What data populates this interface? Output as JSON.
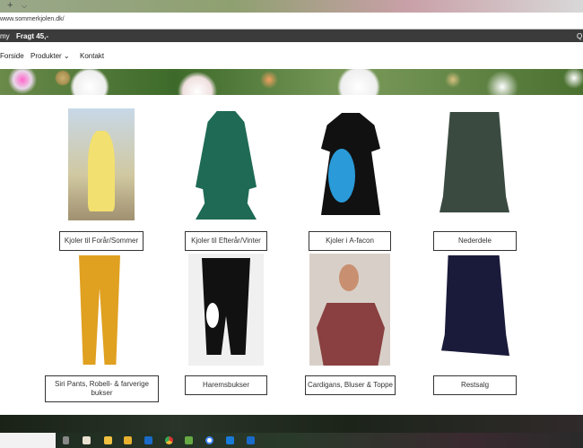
{
  "browser": {
    "new_tab": "+",
    "tab_menu": "⌵",
    "url": "www.sommerkjolen.dk/"
  },
  "topbar": {
    "left": "my",
    "shipping": "Fragt 45,-",
    "right": "Q"
  },
  "nav": {
    "items": [
      {
        "label": "Forside"
      },
      {
        "label": "Produkter ⌄"
      },
      {
        "label": "Kontakt"
      }
    ]
  },
  "products": [
    {
      "label": "Kjoler til Forår/Sommer",
      "color": "#f2e070"
    },
    {
      "label": "Kjoler til Efterår/Vinter",
      "color": "#1e6a55"
    },
    {
      "label": "Kjoler i A-facon",
      "color": "#111111"
    },
    {
      "label": "Nederdele",
      "color": "#3a4a40"
    },
    {
      "label": "Siri Pants, Robell- & farverige bukser",
      "color": "#e0a020"
    },
    {
      "label": "Haremsbukser",
      "color": "#111111"
    },
    {
      "label": "Cardigans, Bluser & Toppe",
      "color": "#8a4040"
    },
    {
      "label": "Restsalg",
      "color": "#1a1a3a"
    }
  ],
  "taskbar": {
    "icons": [
      "task-view",
      "store",
      "file-explorer",
      "files",
      "outlook",
      "chrome",
      "shopify",
      "google",
      "edge",
      "outlook-2"
    ]
  }
}
